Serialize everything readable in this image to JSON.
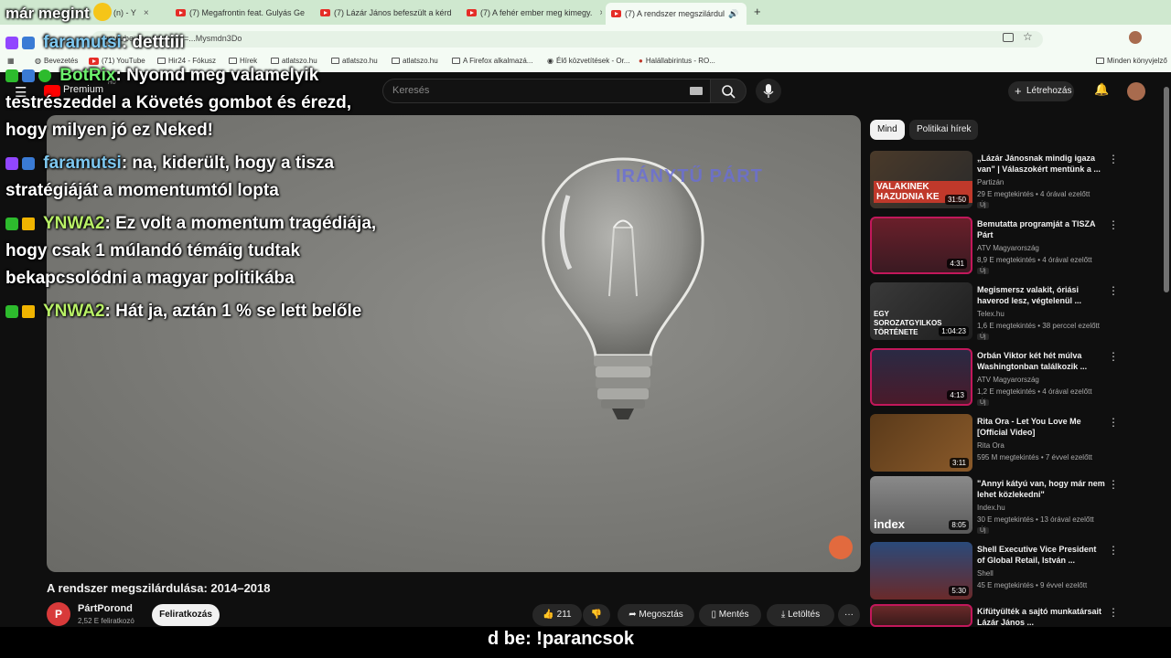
{
  "tabs": [
    {
      "label": "(n) - Y",
      "close": "×"
    },
    {
      "label": "(7) Megafrontin feat. Gulyás Ge",
      "close": "×"
    },
    {
      "label": "(7) Lázár János befeszült a kérd",
      "close": "×"
    },
    {
      "label": "(7) A fehér ember meg kimegy.",
      "close": "×"
    },
    {
      "label": "(7) A rendszer megszilárdul",
      "close": "×"
    }
  ],
  "new_tab": "+",
  "address": {
    "url": "youtube.com/watch?v=...Mysmdn3Do"
  },
  "bookmarks": [
    "Bevezetés",
    "(71) YouTube",
    "Hir24 - Fókusz",
    "Hírek",
    "atlatszo.hu",
    "atlatszo.hu",
    "atlatszo.hu",
    "A Firefox alkalmazá...",
    "Élő közvetítések - Or...",
    "Halállabirintus - RO..."
  ],
  "other_bookmarks": "Minden könyvjelző",
  "youtube": {
    "logo": "Premium",
    "country": "HU",
    "search_placeholder": "Keresés",
    "create_label": "Létrehozás"
  },
  "video": {
    "watermark": "IRÁNYTŰ PÁRT"
  },
  "chat": [
    {
      "user": "már megint",
      "text": ""
    },
    {
      "user": "faramutsi",
      "text": ": detttiii"
    },
    {
      "user": "BotRix",
      "text": ": Nyomd meg valamelyik"
    },
    {
      "user": "",
      "text": "testrészeddel a Követés gombot és érezd,"
    },
    {
      "user": "",
      "text": "hogy milyen jó ez Neked!"
    },
    {
      "user": "faramutsi",
      "text": ": na, kiderült, hogy a tisza"
    },
    {
      "user": "",
      "text": "stratégiáját a momentumtól lopta"
    },
    {
      "user": "YNWA2",
      "text": ": Ez volt a momentum tragédiája,"
    },
    {
      "user": "",
      "text": "hogy csak 1 múlandó témáig tudtak"
    },
    {
      "user": "",
      "text": "bekapcsolódni a magyar politikába"
    },
    {
      "user": "YNWA2",
      "text": ": Hát ja, aztán 1 % se lett belőle"
    }
  ],
  "meta": {
    "title": "A rendszer megszilárdulása: 2014–2018",
    "channel": "PártPorond",
    "subscribers": "2,52 E feliratkozó",
    "subscribe_label": "Feliratkozás",
    "likes": "211",
    "share_label": "Megosztás",
    "save_label": "Mentés",
    "download_label": "Letöltés",
    "more_label": "···"
  },
  "bottom_overlay": "d be: !parancsok",
  "chips": [
    "Mind",
    "Politikai hírek"
  ],
  "recommendations": [
    {
      "title": "„Lázár Jánosnak mindig igaza van\" | Válaszokért mentünk a ...",
      "channel": "Partizán",
      "meta": "29 E megtekintés • 4 órával ezelőtt",
      "new": "Új",
      "duration": "31:50",
      "thumb_text": "VALAKINEK HAZUDNIA KE"
    },
    {
      "title": "Bemutatta programját a TISZA Párt",
      "channel": "ATV Magyarország",
      "meta": "8,9 E megtekintés • 4 órával ezelőtt",
      "new": "Új",
      "duration": "4:31",
      "thumb_text": ""
    },
    {
      "title": "Megismersz valakit, óriási haverod lesz, végtelenül ...",
      "channel": "Telex.hu",
      "meta": "1,6 E megtekintés • 38 perccel ezelőtt",
      "new": "Új",
      "duration": "1:04:23",
      "thumb_text": "EGY SOROZATGYILKOS TÖRTÉNETE"
    },
    {
      "title": "Orbán Viktor két hét múlva Washingtonban találkozik ...",
      "channel": "ATV Magyarország",
      "meta": "1,2 E megtekintés • 4 órával ezelőtt",
      "new": "Új",
      "duration": "4:13",
      "thumb_text": ""
    },
    {
      "title": "Rita Ora - Let You Love Me [Official Video]",
      "channel": "Rita Ora",
      "meta": "595 M megtekintés • 7 évvel ezelőtt",
      "new": "",
      "duration": "3:11",
      "thumb_text": ""
    },
    {
      "title": "\"Annyi kátyú van, hogy már nem lehet közlekedni\"",
      "channel": "Index.hu",
      "meta": "30 E megtekintés • 13 órával ezelőtt",
      "new": "Új",
      "duration": "8:05",
      "thumb_text": "index"
    },
    {
      "title": "Shell Executive Vice President of Global Retail, István ...",
      "channel": "Shell",
      "meta": "45 E megtekintés • 9 évvel ezelőtt",
      "new": "",
      "duration": "5:30",
      "thumb_text": ""
    },
    {
      "title": "Kifütyülték a sajtó munkatársait Lázár János ...",
      "channel": "",
      "meta": "",
      "new": "",
      "duration": "",
      "thumb_text": ""
    }
  ]
}
